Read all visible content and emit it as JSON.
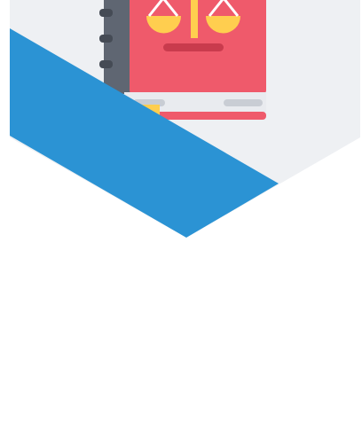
{
  "graphic": {
    "subject": "law-book-icon",
    "colors": {
      "background": "#ffffff",
      "hexagon_fill": "#eef0f3",
      "ribbon_blue": "#2b93d4",
      "book_cover_red": "#ef5a6b",
      "book_spine_gray": "#5f6672",
      "scales_yellow": "#ffce4f",
      "scales_base_dark": "#c93b4d",
      "pages_light": "#e9ebef",
      "pages_gray": "#c9cdd4",
      "bookmark_yellow": "#ffce4f"
    }
  }
}
